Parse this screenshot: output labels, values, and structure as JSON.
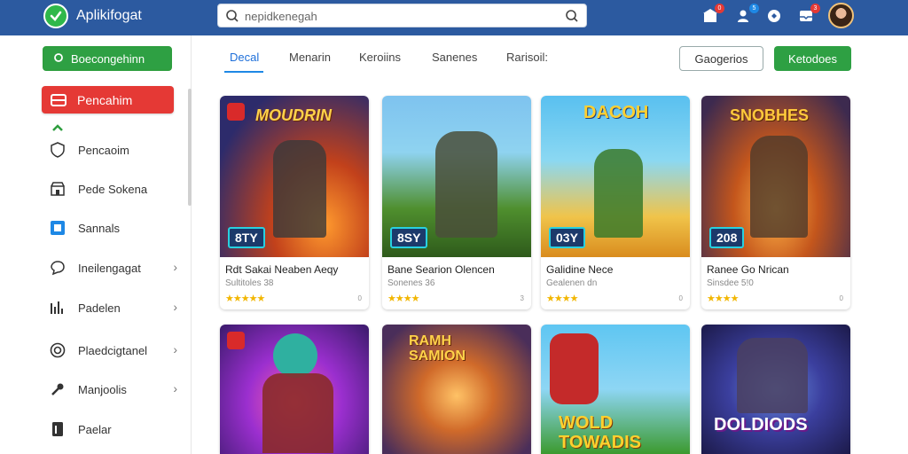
{
  "header": {
    "app_title": "Aplikifogat",
    "search_placeholder": "nepidkenegah",
    "notifications": [
      {
        "badge": "0"
      },
      {
        "badge": "5"
      },
      {
        "badge": ""
      },
      {
        "badge": "3"
      }
    ]
  },
  "sidebar": {
    "top_button": "Boecongehinn",
    "primary_button": "Pencahim",
    "items": [
      {
        "label": "Pencaoim",
        "icon": "shield-icon",
        "chevron": false
      },
      {
        "label": "Pede Sokena",
        "icon": "store-icon",
        "chevron": false
      },
      {
        "label": "Sannals",
        "icon": "grid-icon",
        "chevron": false
      },
      {
        "label": "Ineilengagat",
        "icon": "chat-icon",
        "chevron": true
      },
      {
        "label": "Padelen",
        "icon": "chart-icon",
        "chevron": true
      },
      {
        "label": "Plaedcigtanel",
        "icon": "coin-icon",
        "chevron": true
      },
      {
        "label": "Manjoolis",
        "icon": "tool-icon",
        "chevron": true
      },
      {
        "label": "Paelar",
        "icon": "page-icon",
        "chevron": false
      }
    ]
  },
  "tabs": [
    "Decal",
    "Menarin",
    "Keroiins",
    "Sanenes",
    "Rarisoil:"
  ],
  "actions": {
    "outline_button": "Gaogerios",
    "green_button": "Ketodoes"
  },
  "cards": [
    {
      "art_text": "MOUDRIN",
      "badge": "8TY",
      "title": "Rdt Sakai Neaben Aeqy",
      "sub": "Sultitoles 38",
      "stars": "★★★★★",
      "meta": "0"
    },
    {
      "art_text": "",
      "badge": "8SY",
      "title": "Bane Searion Olencen",
      "sub": "Sonenes 36",
      "stars": "★★★★",
      "meta": "3"
    },
    {
      "art_text": "DACOH",
      "badge": "03Y",
      "title": "Galidine Nece",
      "sub": "Gealenen dn",
      "stars": "★★★★",
      "meta": "0"
    },
    {
      "art_text": "SNOBHES",
      "badge": "208",
      "title": "Ranee Go Nrican",
      "sub": "Sinsdee 5!0",
      "stars": "★★★★",
      "meta": "0"
    },
    {
      "art_text": "",
      "badge": "",
      "title": "",
      "sub": "",
      "stars": "",
      "meta": ""
    },
    {
      "art_text": "RAMH SAMION",
      "badge": "",
      "title": "",
      "sub": "",
      "stars": "",
      "meta": ""
    },
    {
      "art_text": "WOLD TOWADIS",
      "badge": "",
      "title": "",
      "sub": "",
      "stars": "",
      "meta": ""
    },
    {
      "art_text": "DOLDIODS",
      "badge": "",
      "title": "",
      "sub": "",
      "stars": "",
      "meta": ""
    }
  ],
  "colors": {
    "topbar": "#2c5aa0",
    "green": "#2ea043",
    "red": "#e53935",
    "accent": "#1e88e5"
  }
}
